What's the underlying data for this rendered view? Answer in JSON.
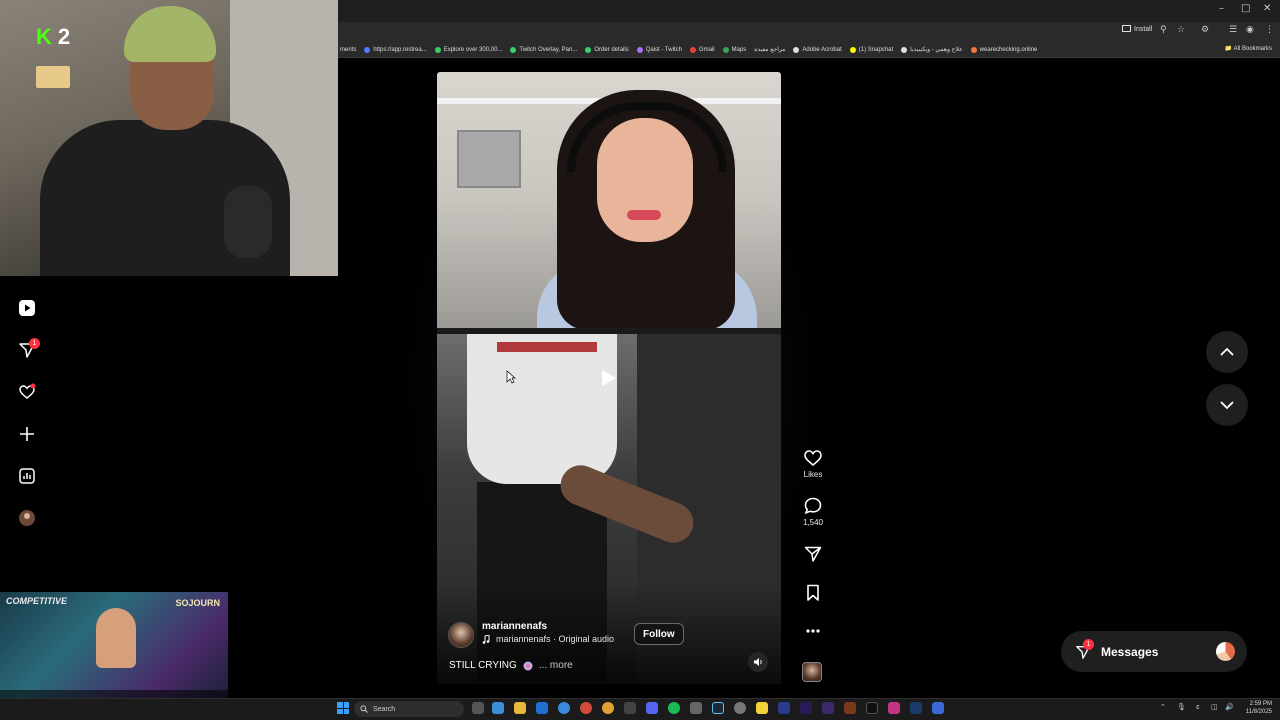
{
  "browser": {
    "install_label": "Install",
    "bookmarks": [
      {
        "label": "ments",
        "color": "#888"
      },
      {
        "label": "https://app.restrea...",
        "color": "#4a7dff"
      },
      {
        "label": "Explore over 300,00...",
        "color": "#3ad06a"
      },
      {
        "label": "Twitch Overlay, Pan...",
        "color": "#3ad06a"
      },
      {
        "label": "Order details",
        "color": "#3ad06a"
      },
      {
        "label": "Qaist - Twitch",
        "color": "#a970ff"
      },
      {
        "label": "Gmail",
        "color": "#ea4335"
      },
      {
        "label": "Maps",
        "color": "#34a853"
      },
      {
        "label": "مراجع مفيدة",
        "color": "#f4b400"
      },
      {
        "label": "Adobe Acrobat",
        "color": "#e0e0e0"
      },
      {
        "label": "(1) Snapchat",
        "color": "#fffc00"
      },
      {
        "label": "علاج وهمي - ويكيبيديا",
        "color": "#e0e0e0"
      },
      {
        "label": "wearechecking.online",
        "color": "#f07b3a"
      }
    ],
    "all_bookmarks_label": "All Bookmarks"
  },
  "stream": {
    "logo_k": "K",
    "logo_number": "2",
    "game_mode": "COMPETITIVE",
    "game_hero": "SOJOURN"
  },
  "sidebar": {
    "items": [
      {
        "icon": "reels-icon"
      },
      {
        "icon": "direct-message-icon",
        "badge": "1"
      },
      {
        "icon": "notifications-icon"
      },
      {
        "icon": "create-icon"
      },
      {
        "icon": "insights-icon"
      },
      {
        "icon": "profile-icon"
      }
    ]
  },
  "reel": {
    "username": "mariannenafs",
    "audio": "mariannenafs · Original audio",
    "follow_label": "Follow",
    "caption": "STILL CRYING",
    "more_label": "... more",
    "likes_label": "Likes",
    "comments_count": "1,540"
  },
  "messages": {
    "label": "Messages",
    "badge": "1"
  },
  "taskbar": {
    "search_placeholder": "Search",
    "time": "2:59 PM",
    "date": "11/8/2025",
    "lang": "ε"
  }
}
